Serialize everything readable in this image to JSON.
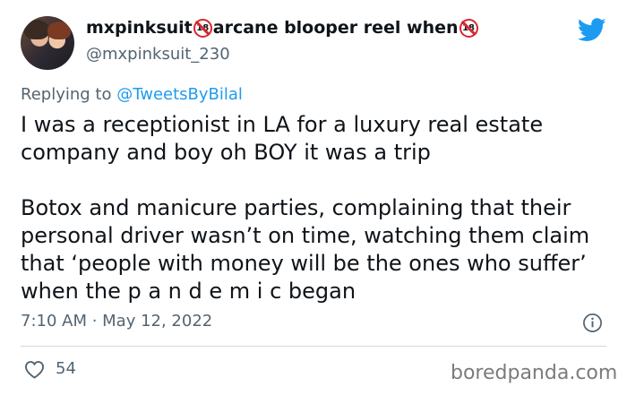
{
  "tweet": {
    "author_name_parts": [
      "mxpinksuit ",
      "arcane blooper reel when"
    ],
    "author_badge_icon": "no-under-18-icon",
    "author_badge_text": "18",
    "handle": "@mxpinksuit_230",
    "replying_prefix": "Replying to ",
    "replying_to": "@TweetsByBilal",
    "text": "I was a receptionist in LA for a luxury real estate company and boy oh BOY it was a trip\n\nBotox and manicure parties, complaining that their personal driver wasn’t on time, watching them claim that ‘people with money will be the ones who suffer’ when the p a n d e m i c began",
    "timestamp": "7:10 AM · May 12, 2022",
    "like_count": "54"
  },
  "icons": {
    "platform": "twitter-bird-icon",
    "info": "info-icon",
    "like": "heart-icon"
  },
  "colors": {
    "twitter_blue": "#1d9bf0",
    "secondary_text": "#536471",
    "badge_red": "#d9262d"
  },
  "watermark": "boredpanda.com"
}
